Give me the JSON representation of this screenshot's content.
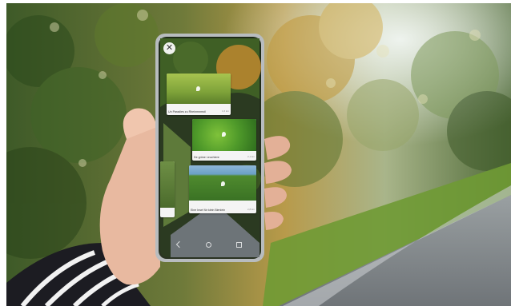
{
  "scene": {
    "subject": "hand-holding-smartphone",
    "colors": {
      "foliage_dark": "#2f4a1f",
      "foliage_light": "#8fb04a",
      "autumn": "#c9a243",
      "road": "#8a8f92",
      "grass": "#7aa63a",
      "sky": "#e8efe9"
    }
  },
  "app": {
    "close_icon": "close-icon",
    "cards": [
      {
        "caption": "Un Paradies zu Rheinmnmstl",
        "meta": "1,6 km"
      },
      {
        "caption": "De grüne Leuchtere",
        "meta": "2,1 km"
      },
      {
        "caption": "Eine Insel für klein Bienlein",
        "meta": "2,8 km"
      }
    ],
    "side_card": {
      "caption": ""
    }
  }
}
